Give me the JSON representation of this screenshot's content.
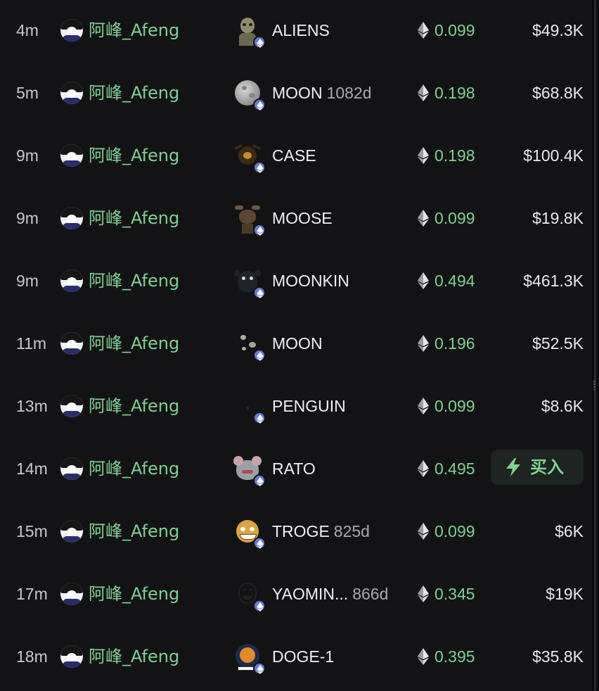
{
  "feed": {
    "user": "阿峰_Afeng",
    "rows": [
      {
        "time": "4m",
        "token": "ALIENS",
        "age": "",
        "amount": "0.099",
        "mcap": "$49.3K",
        "token_icon": "aliens-token-icon"
      },
      {
        "time": "5m",
        "token": "MOON",
        "age": "1082d",
        "amount": "0.198",
        "mcap": "$68.8K",
        "token_icon": "moon-token-icon"
      },
      {
        "time": "9m",
        "token": "CASE",
        "age": "",
        "amount": "0.198",
        "mcap": "$100.4K",
        "token_icon": "case-token-icon"
      },
      {
        "time": "9m",
        "token": "MOOSE",
        "age": "",
        "amount": "0.099",
        "mcap": "$19.8K",
        "token_icon": "moose-token-icon"
      },
      {
        "time": "9m",
        "token": "MOONKIN",
        "age": "",
        "amount": "0.494",
        "mcap": "$461.3K",
        "token_icon": "moonkin-token-icon"
      },
      {
        "time": "11m",
        "token": "MOON",
        "age": "",
        "amount": "0.196",
        "mcap": "$52.5K",
        "token_icon": "moon-token-icon"
      },
      {
        "time": "13m",
        "token": "PENGUIN",
        "age": "",
        "amount": "0.099",
        "mcap": "$8.6K",
        "token_icon": "penguin-token-icon"
      },
      {
        "time": "14m",
        "token": "RATO",
        "age": "",
        "amount": "0.495",
        "mcap": "",
        "token_icon": "rato-token-icon"
      },
      {
        "time": "15m",
        "token": "TROGE",
        "age": "825d",
        "amount": "0.099",
        "mcap": "$6K",
        "token_icon": "troge-token-icon"
      },
      {
        "time": "17m",
        "token": "YAOMIN...",
        "age": "866d",
        "amount": "0.345",
        "mcap": "$19K",
        "token_icon": "yaoming-token-icon"
      },
      {
        "time": "18m",
        "token": "DOGE-1",
        "age": "",
        "amount": "0.395",
        "mcap": "$35.8K",
        "token_icon": "doge1-token-icon"
      }
    ],
    "buy_button": {
      "label": "买入",
      "icon": "lightning-icon",
      "row_index": 7
    }
  },
  "colors": {
    "background": "#131316",
    "accent_green": "#7fd190",
    "text_primary": "#e9e9ec",
    "text_muted": "#a9a9b0",
    "eth_badge": "#6779d8"
  }
}
